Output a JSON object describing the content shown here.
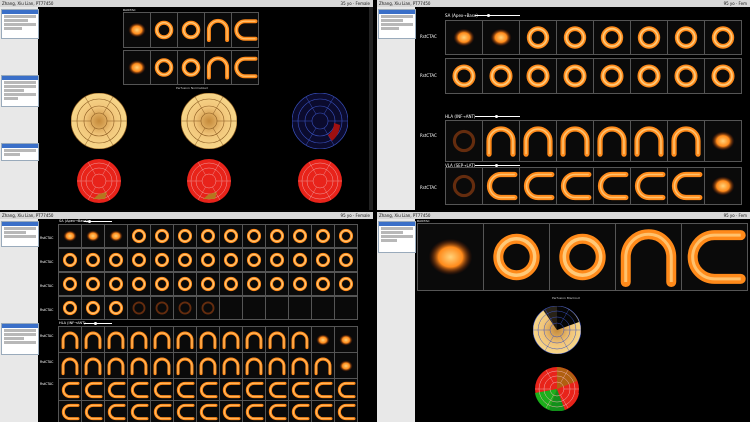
{
  "q1": {
    "title": "Zhang, Xiu Lian, PT77450",
    "right": "35 yo · Female",
    "label_top": "RstCTAC",
    "caption": "Perfusion Normalized"
  },
  "q2": {
    "title": "Zhang, Xiu Lian, PT77450",
    "right": "95 yo · Fem",
    "row1_label": "SA (Apex→Base)",
    "rest1": "RstCTAC",
    "rest2": "RstCTAC",
    "row2_label": "HLA (INF→ANT)",
    "rest3": "RstCTAC",
    "row3_label": "VLA (SEP→LAT)",
    "rest4": "RstCTAC"
  },
  "q3": {
    "title": "Zhang, Xiu Lian, PT77450",
    "right": "95 yo · Female",
    "row1_label": "SA (Apex→Base)",
    "row2_label": "HLA (INF→ANT)",
    "row3_label": "VLA (SEP→LAT)",
    "rest_labels": [
      "RstCTAC",
      "RstCTAC",
      "RstCTAC",
      "RstCTAC",
      "RstCTAC",
      "RstCTAC",
      "RstCTAC"
    ]
  },
  "q4": {
    "title": "Zhang, Xiu Lian, PT77450",
    "right": "95 yo · Fem",
    "label_top": "RstCTAC",
    "caption": "Perfusion Blackout"
  },
  "colors": {
    "orange": "#ff8a1a",
    "red": "#e8231a",
    "green": "#1bb01b",
    "tan": "#f0c070"
  }
}
